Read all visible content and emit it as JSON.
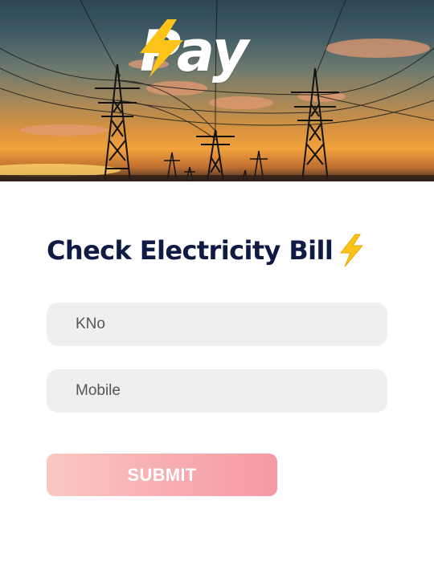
{
  "header": {
    "logo_text": "Pay",
    "logo_icon": "lightning-bolt-icon",
    "image_subject": "electricity-pylons-at-sunset"
  },
  "form": {
    "title": "Check Electricity Bill",
    "title_icon": "lightning-bolt-emoji",
    "kno_placeholder": "KNo",
    "mobile_placeholder": "Mobile",
    "submit_label": "SUBMIT"
  },
  "colors": {
    "title": "#0f1a45",
    "bolt_yellow": "#fcc419",
    "input_bg": "#efefef",
    "button_gradient_start": "#fbc9c1",
    "button_gradient_end": "#f59aa4"
  }
}
